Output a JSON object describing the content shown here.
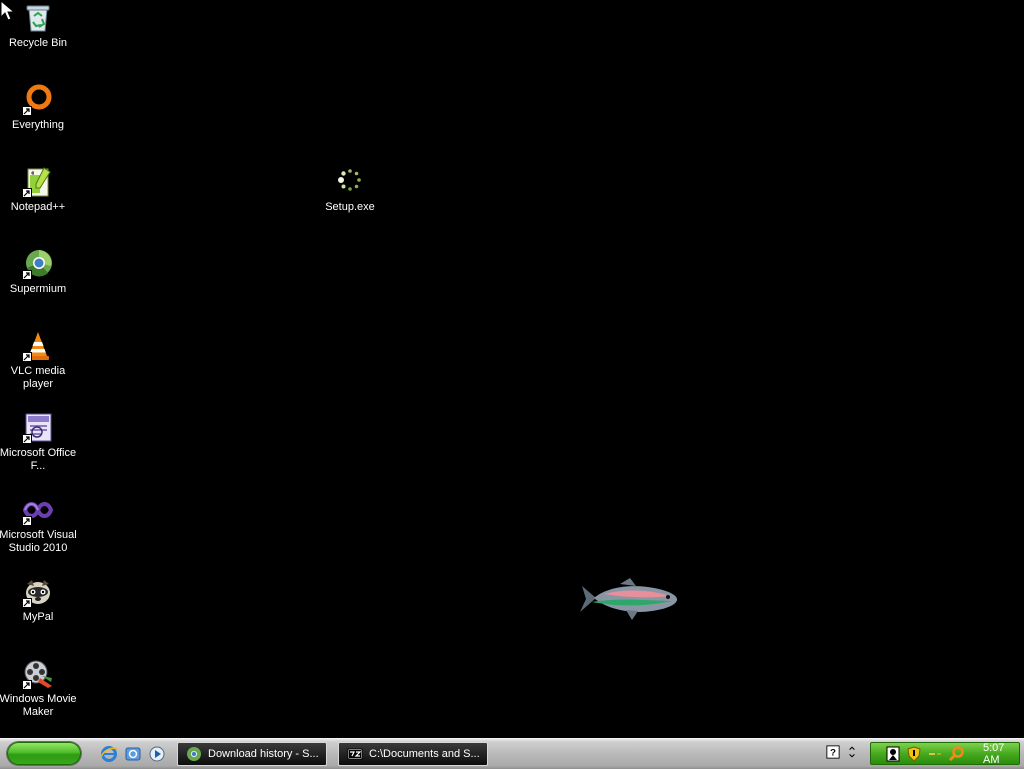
{
  "desktop": {
    "icons": [
      {
        "label": "Recycle Bin",
        "icon": "recycle-bin-icon",
        "shortcut": false
      },
      {
        "label": "Everything",
        "icon": "everything-icon",
        "shortcut": true
      },
      {
        "label": "Notepad++",
        "icon": "notepadpp-icon",
        "shortcut": true
      },
      {
        "label": "Supermium",
        "icon": "supermium-icon",
        "shortcut": true
      },
      {
        "label": "VLC media player",
        "icon": "vlc-icon",
        "shortcut": true
      },
      {
        "label": "Microsoft Office F...",
        "icon": "office-icon",
        "shortcut": true
      },
      {
        "label": "Microsoft Visual Studio 2010",
        "icon": "visual-studio-icon",
        "shortcut": true
      },
      {
        "label": "MyPal",
        "icon": "mypal-icon",
        "shortcut": true
      },
      {
        "label": "Windows Movie Maker",
        "icon": "movie-maker-icon",
        "shortcut": true
      }
    ],
    "setup": {
      "label": "Setup.exe",
      "icon": "setup-exe-icon"
    }
  },
  "taskbar": {
    "quicklaunch": [
      "internet-explorer-icon",
      "show-desktop-icon",
      "media-player-icon"
    ],
    "tasks": [
      {
        "label": "Download history - S...",
        "icon": "supermium-icon"
      },
      {
        "label": "C:\\Documents and S...",
        "icon": "7zip-icon"
      }
    ],
    "tray_extra": [
      "help-icon",
      "chevron-icon"
    ],
    "tray_icons": [
      "network-icon",
      "security-shield-icon",
      "volume-icon",
      "search-icon"
    ],
    "clock": "5:07 AM"
  },
  "colors": {
    "desktop_bg": "#000000",
    "start_green": "#3aa81b",
    "tray_green": "#48aa1f",
    "task_bg": "#0d0d0d"
  }
}
